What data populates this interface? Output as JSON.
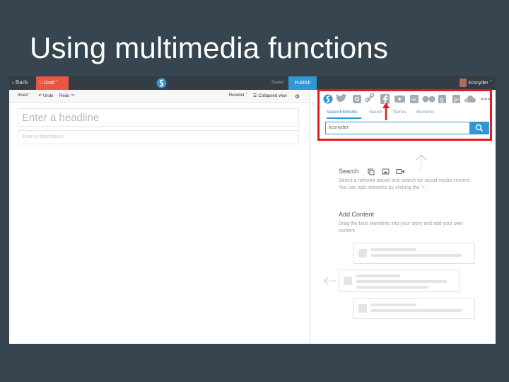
{
  "slide": {
    "title": "Using multimedia functions"
  },
  "app": {
    "topbar": {
      "back_label": "Back",
      "draft_label": "Draft",
      "saved_label": "Saved",
      "publish_label": "Publish",
      "username": "kcsnyder"
    },
    "toolbar": {
      "insert_label": "Insert",
      "undo_label": "Undo",
      "redo_label": "Redo",
      "reorder_label": "Reorder",
      "collapsed_view_label": "Collapsed view"
    },
    "editor": {
      "headline_placeholder": "Enter a headline",
      "description_placeholder": "Enter a description"
    },
    "panel": {
      "social_icons": [
        "storify-icon",
        "twitter-icon",
        "instagram-icon",
        "link-icon",
        "facebook-icon",
        "youtube-icon",
        "vk-icon",
        "flickr-icon",
        "google-icon",
        "google-plus-icon",
        "soundcloud-icon",
        "more-icon"
      ],
      "tabs": [
        "Saved Elements",
        "Search",
        "Stories",
        "Elements"
      ],
      "active_tab": "Saved Elements",
      "search_value": "kcsnyder",
      "search_heading": "Search",
      "search_text": "Select a network above and search for social media content. You can add networks by clicking the '+'.",
      "add_content_heading": "Add Content",
      "add_content_text": "Drag the best elements into your story and add your own content"
    },
    "colors": {
      "slide_bg": "#36454f",
      "topbar": "#343c44",
      "draft": "#e8563f",
      "publish": "#2f97d6",
      "highlight": "#e01b1b"
    }
  }
}
